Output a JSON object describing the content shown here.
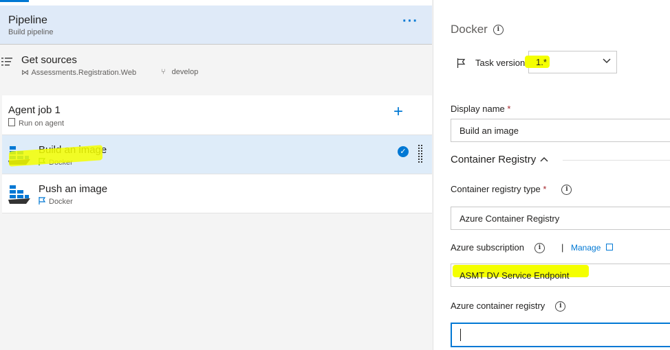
{
  "pipeline": {
    "title": "Pipeline",
    "subtitle": "Build pipeline",
    "more": "···"
  },
  "get_sources": {
    "title": "Get sources",
    "repo": "Assessments.Registration.Web",
    "branch": "develop"
  },
  "agent_job": {
    "title": "Agent job 1",
    "subtitle": "Run on agent",
    "add": "+"
  },
  "tasks": [
    {
      "title": "Build an image",
      "subtitle": "Docker",
      "selected": true
    },
    {
      "title": "Push an image",
      "subtitle": "Docker",
      "selected": false
    }
  ],
  "panel": {
    "title": "Docker",
    "task_version_label": "Task version",
    "task_version_value": "1.*",
    "display_name_label": "Display name",
    "display_name_value": "Build an image",
    "section_container_registry": "Container Registry",
    "container_registry_type_label": "Container registry type",
    "container_registry_type_value": "Azure Container Registry",
    "azure_subscription_label": "Azure subscription",
    "manage_link": "Manage",
    "azure_subscription_value": "ASMT DV Service Endpoint",
    "azure_container_registry_label": "Azure container registry",
    "azure_container_registry_value": ""
  },
  "colors": {
    "accent": "#0078d4",
    "selected_bg": "#deecf9",
    "highlight": "#f4ff00",
    "required": "#a4262c"
  }
}
